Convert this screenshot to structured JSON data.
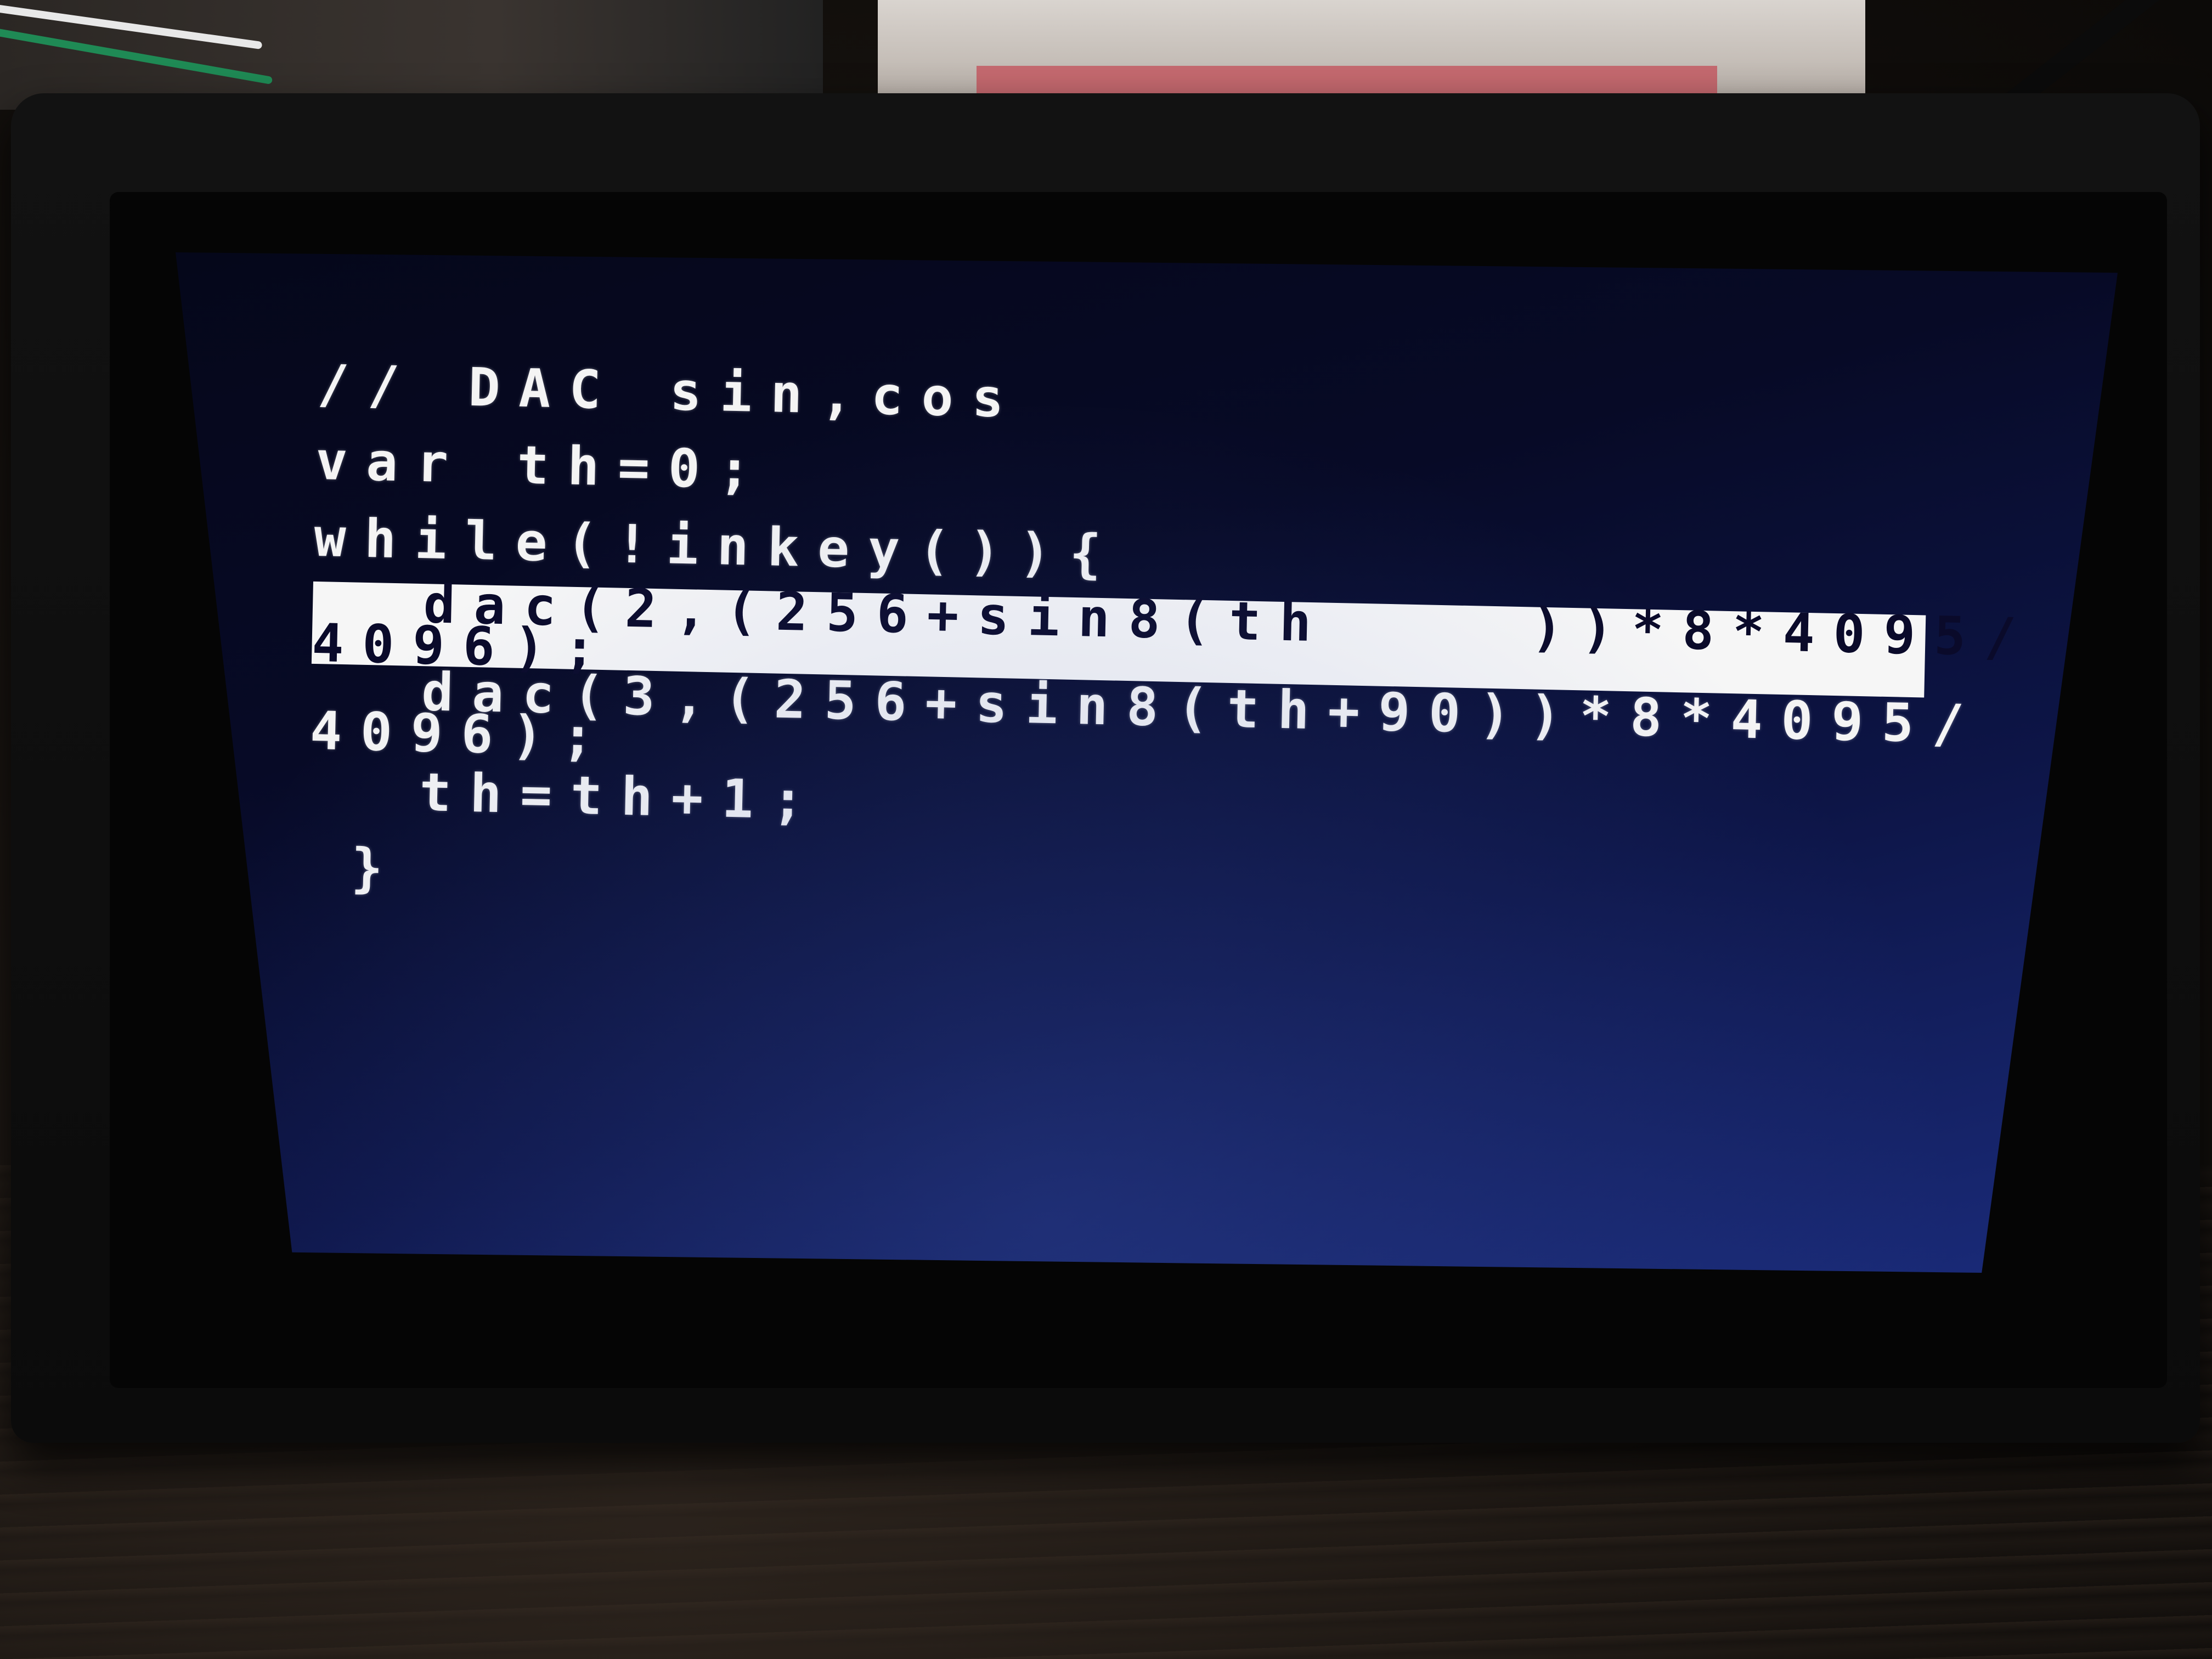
{
  "screen": {
    "lines": [
      "// DAC sin,cos",
      "var th=0;",
      "while(!inkey()){",
      " dac(2,(256+sin8(th    ))*8*4095/",
      "4096);",
      " dac(3,(256+sin8(th+90))*8*4095/",
      "4096);",
      " th=th+1;",
      "}"
    ],
    "highlighted_line_index": 3
  },
  "colors": {
    "screen_bg_top": "#05071a",
    "screen_bg_bottom": "#1a2b7a",
    "text": "#f4f4f4",
    "highlight_bg": "#f6f6f6"
  }
}
